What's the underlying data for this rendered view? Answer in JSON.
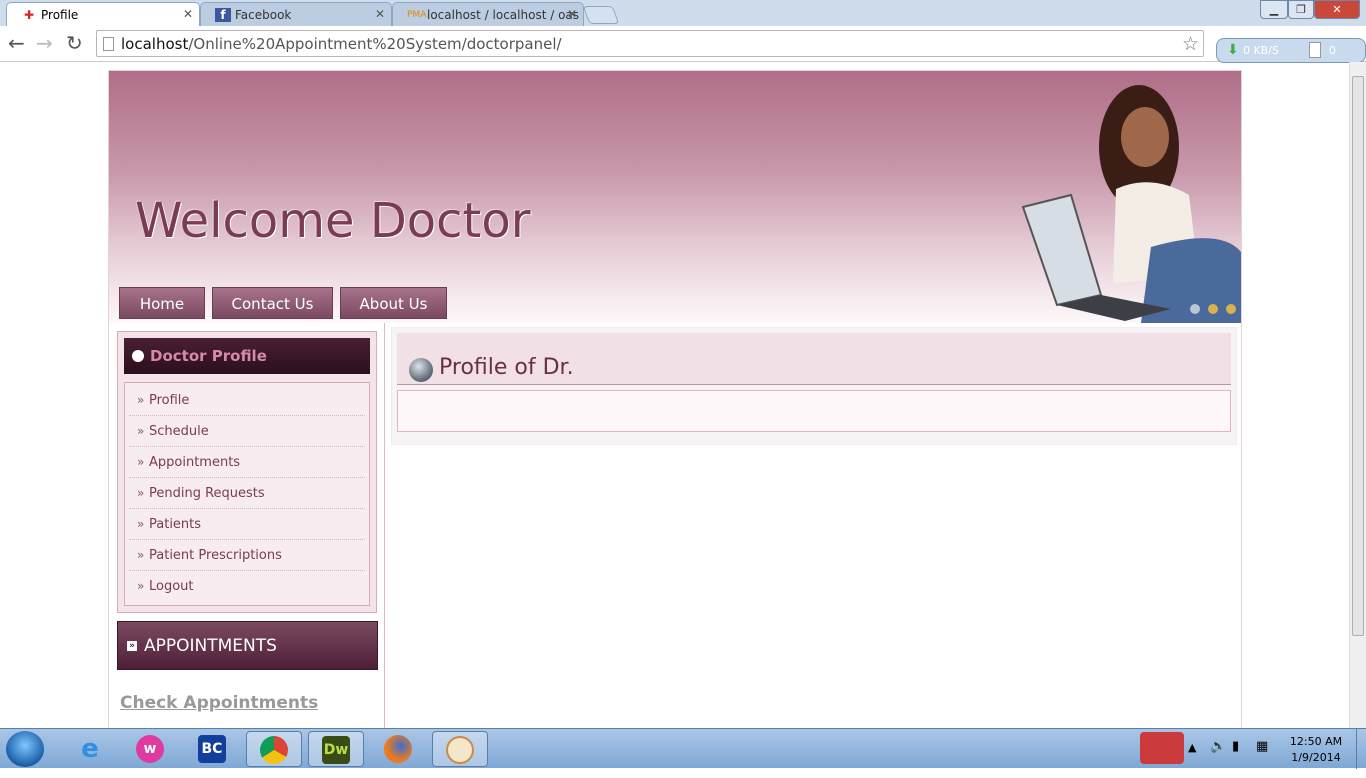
{
  "browser": {
    "tabs": [
      {
        "title": "Profile",
        "active": true,
        "icon": "red-cross-icon"
      },
      {
        "title": "Facebook",
        "active": false,
        "icon": "facebook-icon"
      },
      {
        "title": "localhost / localhost / oas",
        "active": false,
        "icon": "phpmyadmin-icon"
      }
    ],
    "url_host": "localhost",
    "url_path": "/Online%20Appointment%20System/doctorpanel/",
    "extension": {
      "speed": "0 KB/S",
      "count": "0"
    }
  },
  "header": {
    "title": "Welcome Doctor",
    "nav": [
      "Home",
      "Contact Us",
      "About Us"
    ]
  },
  "sidebar": {
    "section_title": "Doctor Profile",
    "items": [
      "Profile",
      "Schedule",
      "Appointments",
      "Pending Requests",
      "Patients",
      "Patient Prescriptions",
      "Logout"
    ],
    "appointments_title": "APPOINTMENTS",
    "check_link": "Check Appointments"
  },
  "content": {
    "heading": "Profile of Dr.",
    "body": ""
  },
  "taskbar": {
    "apps": [
      "ie",
      "wamp",
      "BC",
      "chrome",
      "Dw",
      "firefox",
      "paint"
    ],
    "time": "12:50 AM",
    "date": "1/9/2014"
  },
  "colors": {
    "accent": "#7a3b55",
    "header_top": "#b06e88",
    "dark_panel": "#4e2038"
  }
}
